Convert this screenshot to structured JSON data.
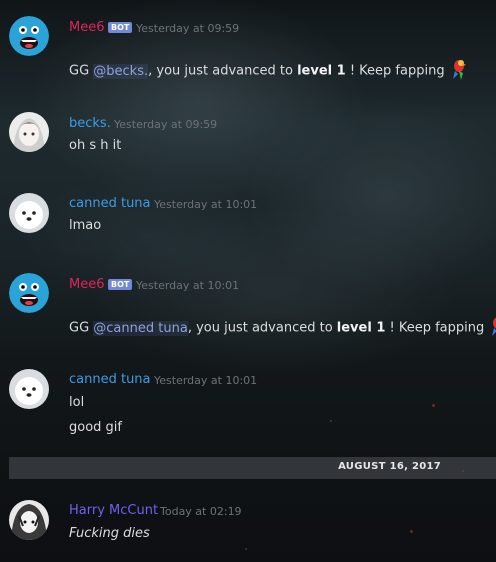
{
  "messages": [
    {
      "id": "m1",
      "author": "Mee6",
      "author_color": "#e1245a",
      "bot_label": "BOT",
      "timestamp": "Yesterday at 09:59",
      "lines": [
        {
          "pre": "GG ",
          "mention": "@becks.",
          "mid": ", you just advanced to ",
          "level": "level 1",
          "post": " ! Keep fapping"
        }
      ]
    },
    {
      "id": "m2",
      "author": "becks.",
      "author_color": "#3a9de8",
      "timestamp": "Yesterday at 09:59",
      "lines": [
        "oh s h it"
      ]
    },
    {
      "id": "m3",
      "author": "canned tuna",
      "author_color": "#3a9de8",
      "timestamp": "Yesterday at 10:01",
      "lines": [
        "lmao"
      ]
    },
    {
      "id": "m4",
      "author": "Mee6",
      "author_color": "#e1245a",
      "bot_label": "BOT",
      "timestamp": "Yesterday at 10:01",
      "lines": [
        {
          "pre": "GG ",
          "mention": "@canned tuna",
          "mid": ", you just advanced to ",
          "level": "level 1",
          "post": " ! Keep fapping"
        }
      ]
    },
    {
      "id": "m5",
      "author": "canned tuna",
      "author_color": "#3a9de8",
      "timestamp": "Yesterday at 10:01",
      "lines": [
        "lol",
        "good gif"
      ]
    },
    {
      "id": "m6",
      "author": "Harry McCunt",
      "author_color": "#6f5ff1",
      "timestamp": "Today at 02:19",
      "lines": [
        "Fucking dies"
      ]
    }
  ],
  "divider": {
    "label": "AUGUST 16, 2017"
  },
  "icons": {
    "avatar_mee6": "mee6-avatar-icon",
    "avatar_dog": "samoyed-avatar-icon",
    "avatar_anime": "anime-avatar-icon",
    "emoji": "parrot-emoji-icon"
  }
}
